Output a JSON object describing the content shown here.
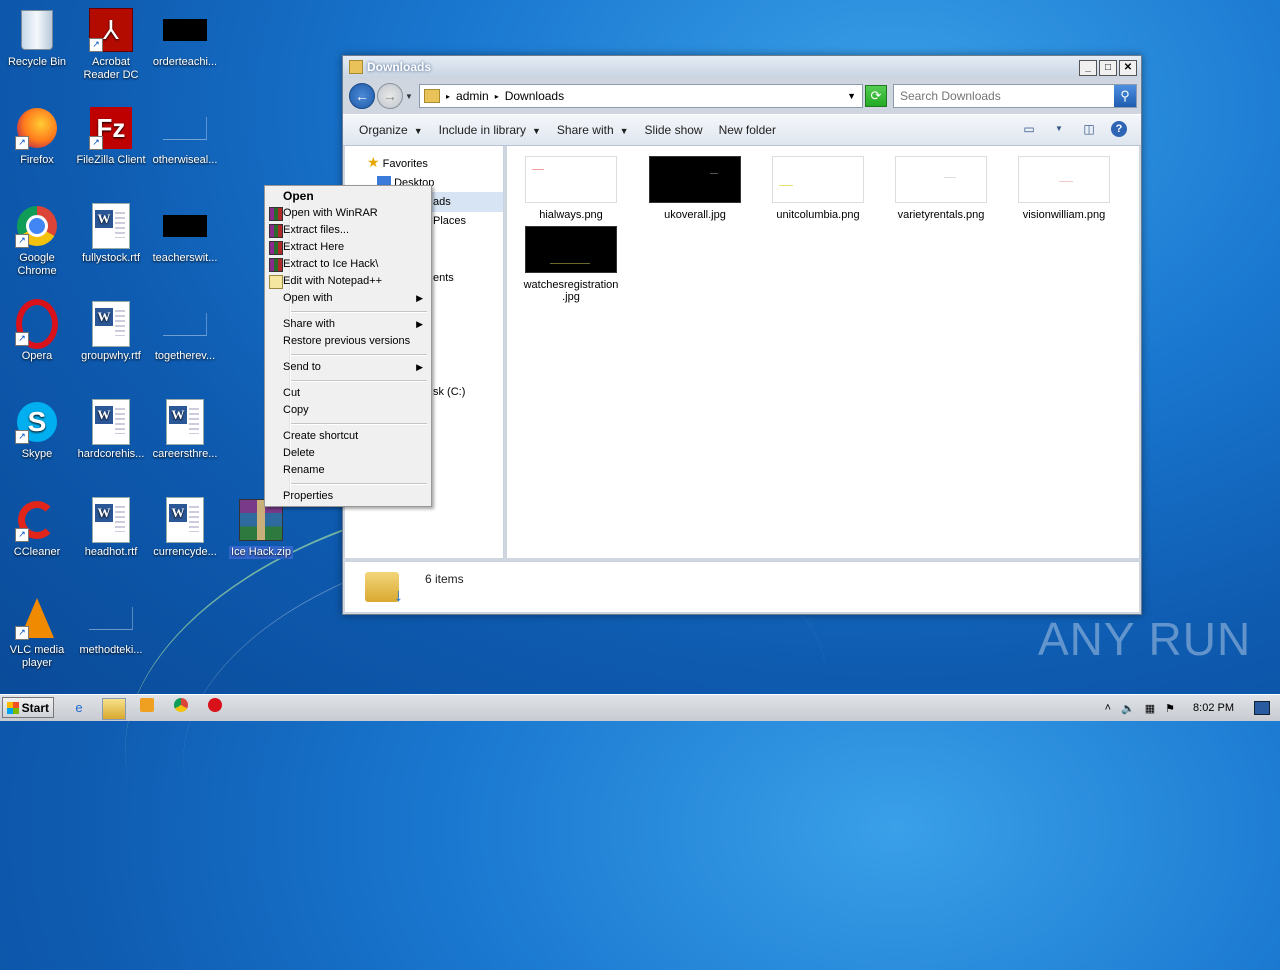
{
  "desktop": {
    "icons": [
      {
        "label": "Recycle Bin"
      },
      {
        "label": "Acrobat Reader DC"
      },
      {
        "label": "orderteachi..."
      },
      {
        "label": "Firefox"
      },
      {
        "label": "FileZilla Client"
      },
      {
        "label": "otherwiseal..."
      },
      {
        "label": "Google Chrome"
      },
      {
        "label": "fullystock.rtf"
      },
      {
        "label": "teacherswit..."
      },
      {
        "label": "Opera"
      },
      {
        "label": "groupwhy.rtf"
      },
      {
        "label": "togetherev..."
      },
      {
        "label": "Skype"
      },
      {
        "label": "hardcorehis..."
      },
      {
        "label": "careersthre..."
      },
      {
        "label": "CCleaner"
      },
      {
        "label": "headhot.rtf"
      },
      {
        "label": "currencyde..."
      },
      {
        "label": "Ice Hack.zip"
      },
      {
        "label": "VLC media player"
      },
      {
        "label": "methodteki..."
      }
    ]
  },
  "explorer": {
    "title": "Downloads",
    "breadcrumb": [
      "admin",
      "Downloads"
    ],
    "search_placeholder": "Search Downloads",
    "toolbar": {
      "organize": "Organize",
      "include": "Include in library",
      "share": "Share with",
      "slideshow": "Slide show",
      "newfolder": "New folder"
    },
    "nav": {
      "favorites": "Favorites",
      "desktop": "Desktop",
      "downloads_partial": "ads",
      "recent_partial": "Places",
      "docs_partial": "ents",
      "disk_partial": "sk (C:)"
    },
    "files": [
      {
        "name": "hialways.png"
      },
      {
        "name": "ukoverall.jpg"
      },
      {
        "name": "unitcolumbia.png"
      },
      {
        "name": "varietyrentals.png"
      },
      {
        "name": "visionwilliam.png"
      },
      {
        "name": "watchesregistration.jpg",
        "line1": "watchesregistration",
        "line2": ".jpg"
      }
    ],
    "status": "6 items"
  },
  "context_menu": {
    "open": "Open",
    "open_winrar": "Open with WinRAR",
    "extract_files": "Extract files...",
    "extract_here": "Extract Here",
    "extract_to": "Extract to Ice Hack\\",
    "edit_notepad": "Edit with Notepad++",
    "open_with": "Open with",
    "share_with": "Share with",
    "restore": "Restore previous versions",
    "send_to": "Send to",
    "cut": "Cut",
    "copy": "Copy",
    "create_shortcut": "Create shortcut",
    "delete": "Delete",
    "rename": "Rename",
    "properties": "Properties"
  },
  "taskbar": {
    "start": "Start",
    "clock": "8:02 PM"
  },
  "watermark": "ANY RUN"
}
